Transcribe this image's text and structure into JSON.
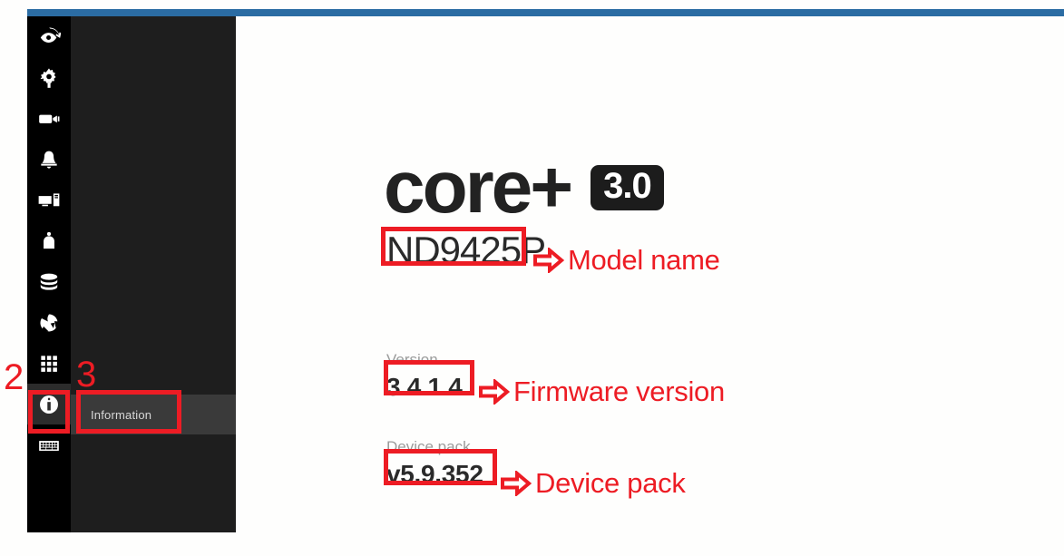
{
  "theme": {
    "accent_bar": "#2b6ca3",
    "rail_bg": "#000000",
    "panel_bg": "#1e1e1e",
    "panel_selected_bg": "#3a3a3a",
    "content_bg": "#fefefd",
    "annotation_red": "#ed1c24",
    "badge_bg": "#1c1c1c",
    "label_gray": "#9b9b9b",
    "text_dark": "#2a2a2a"
  },
  "sidebar": {
    "icons": [
      {
        "name": "playback-review-icon",
        "glyph": "eye-with-arrow"
      },
      {
        "name": "settings-gear-icon",
        "glyph": "gear"
      },
      {
        "name": "camera-icon",
        "glyph": "video-camera"
      },
      {
        "name": "alarm-bell-icon",
        "glyph": "bell"
      },
      {
        "name": "system-monitor-icon",
        "glyph": "monitor-and-server"
      },
      {
        "name": "user-account-icon",
        "glyph": "person"
      },
      {
        "name": "storage-icon",
        "glyph": "disk-stack"
      },
      {
        "name": "network-icon",
        "glyph": "globe-network"
      },
      {
        "name": "apps-grid-icon",
        "glyph": "grid-9"
      },
      {
        "name": "information-icon",
        "glyph": "info-circle"
      },
      {
        "name": "keyboard-icon",
        "glyph": "keyboard"
      }
    ]
  },
  "submenu": {
    "items": [
      {
        "label": "Information",
        "selected": true
      }
    ]
  },
  "main": {
    "logo": {
      "word": "core+",
      "badge": "3.0"
    },
    "model_name": "ND9425P",
    "fields": [
      {
        "label": "Version",
        "value": "3.4.1.4"
      },
      {
        "label": "Device pack",
        "value": "v5.9.352"
      }
    ]
  },
  "annotations": {
    "numbers": [
      {
        "text": "2"
      },
      {
        "text": "3"
      }
    ],
    "callouts": [
      {
        "text": "Model name",
        "arrow": "right-arrow-outline"
      },
      {
        "text": "Firmware version",
        "arrow": "right-arrow-outline"
      },
      {
        "text": "Device pack",
        "arrow": "right-arrow-outline"
      }
    ]
  }
}
